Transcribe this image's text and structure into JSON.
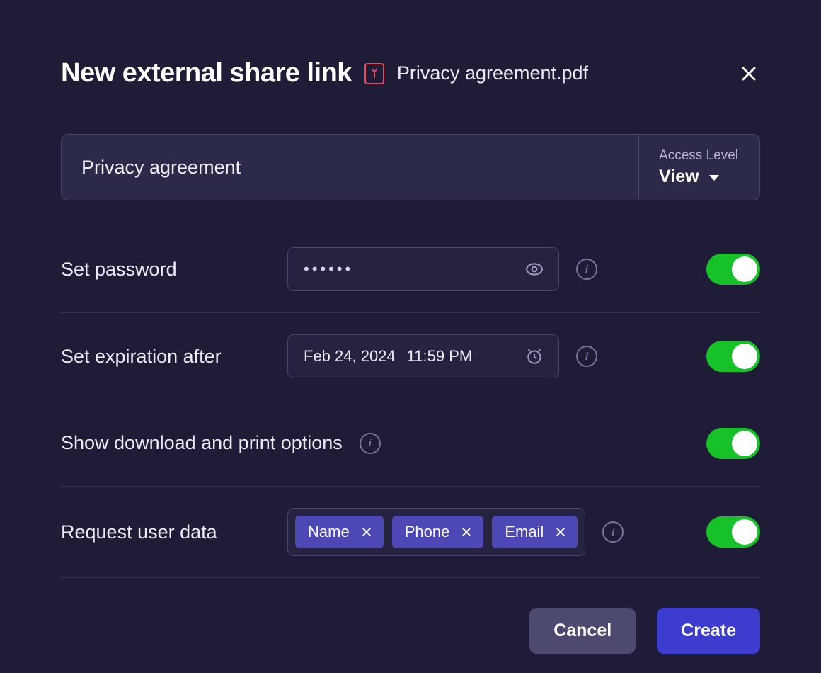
{
  "header": {
    "title": "New external share link",
    "filename": "Privacy agreement.pdf"
  },
  "link_name": "Privacy agreement",
  "access": {
    "label": "Access Level",
    "value": "View"
  },
  "password": {
    "label": "Set password",
    "masked": "••••••",
    "enabled": true
  },
  "expiration": {
    "label": "Set expiration after",
    "date": "Feb 24, 2024",
    "time": "11:59 PM",
    "enabled": true
  },
  "download": {
    "label": "Show download and print options",
    "enabled": true
  },
  "user_data": {
    "label": "Request user data",
    "chips": [
      "Name",
      "Phone",
      "Email"
    ],
    "enabled": true
  },
  "footer": {
    "cancel": "Cancel",
    "create": "Create"
  }
}
